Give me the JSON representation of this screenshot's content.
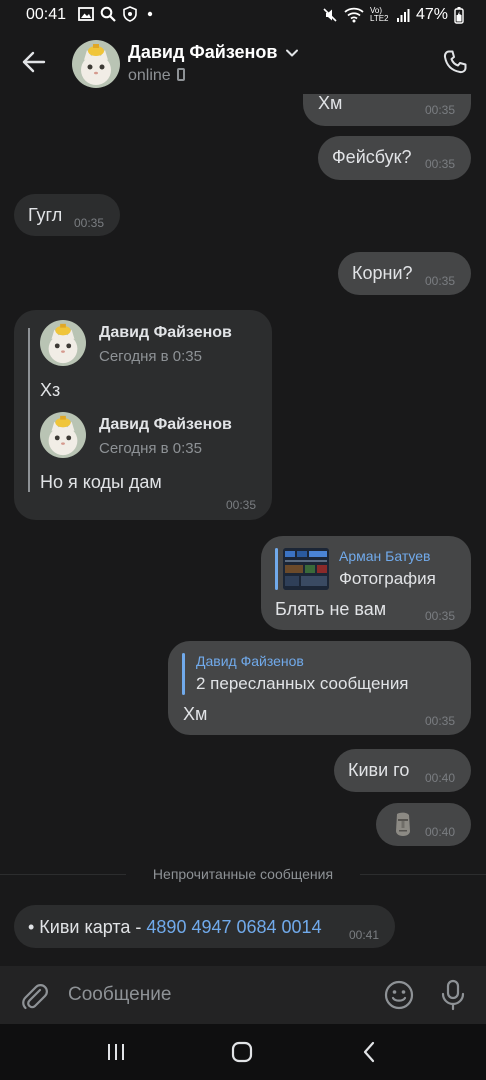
{
  "status_bar": {
    "time": "00:41",
    "network": "Vo) LTE2",
    "battery": "47%"
  },
  "header": {
    "contact_name": "Давид Файзенов",
    "status": "online"
  },
  "messages": [
    {
      "dir": "out",
      "text": "Хм",
      "time": "00:35"
    },
    {
      "dir": "out",
      "text": "Фейсбук?",
      "time": "00:35"
    },
    {
      "dir": "in",
      "text": "Гугл",
      "time": "00:35"
    },
    {
      "dir": "out",
      "text": "Корни?",
      "time": "00:35"
    },
    {
      "dir": "in",
      "forwarded": [
        {
          "name": "Давид Файзенов",
          "date": "Сегодня в 0:35",
          "text": "Хз"
        },
        {
          "name": "Давид Файзенов",
          "date": "Сегодня в 0:35",
          "text": "Но я коды дам"
        }
      ],
      "time": "00:35"
    },
    {
      "dir": "out",
      "reply_name": "Арман Батуев",
      "reply_sub": "Фотография",
      "text": "Блять не вам",
      "time": "00:35"
    },
    {
      "dir": "out",
      "reply_name": "Давид Файзенов",
      "reply_sub": "2 пересланных сообщения",
      "text": "Хм",
      "time": "00:35"
    },
    {
      "dir": "out",
      "text": "Киви го",
      "time": "00:40"
    },
    {
      "dir": "out",
      "sticker": "moai-emoji",
      "time": "00:40"
    },
    {
      "dir": "in",
      "text_prefix": "• Киви карта - ",
      "text_link": "4890 4947 0684 0014",
      "time": "00:41"
    }
  ],
  "unread_label": "Непрочитанные сообщения",
  "composer": {
    "placeholder": "Сообщение"
  },
  "colors": {
    "background": "#19191a",
    "incoming_bubble": "#2c2d2e",
    "outgoing_bubble": "#454647",
    "accent": "#71aaeb"
  }
}
